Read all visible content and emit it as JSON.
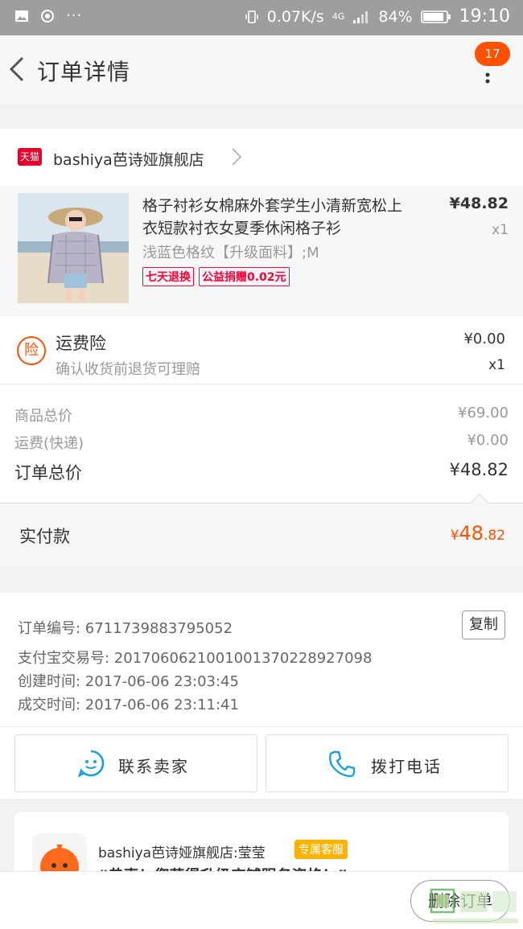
{
  "status_bar": {
    "network_speed": "0.07K/s",
    "network_type": "4G",
    "battery": "84%",
    "time": "19:10"
  },
  "nav": {
    "title": "订单详情",
    "badge_count": "17"
  },
  "shop": {
    "badge": "天猫",
    "name": "bashiya芭诗娅旗舰店"
  },
  "product": {
    "title": "格子衬衫女棉麻外套学生小清新宽松上衣短款衬衣女夏季休闲格子衫",
    "sku": "浅蓝色格纹【升级面料】;M",
    "price": "¥48.82",
    "quantity": "x1",
    "tags": [
      "七天退换",
      "公益捐赠0.02元"
    ]
  },
  "insurance": {
    "icon_char": "险",
    "title": "运费险",
    "desc": "确认收货前退货可理赔",
    "price": "¥0.00",
    "quantity": "x1"
  },
  "totals": {
    "goods_label": "商品总价",
    "goods_value": "¥69.00",
    "shipping_label": "运费(快递)",
    "shipping_value": "¥0.00",
    "order_label": "订单总价",
    "order_value": "¥48.82"
  },
  "paid": {
    "label": "实付款",
    "currency": "¥",
    "integer": "48",
    "cents": ".82"
  },
  "order_info": {
    "order_no": "订单编号: 6711739883795052",
    "alipay_no": "支付宝交易号: 2017060621001001370228927098",
    "created": "创建时间: 2017-06-06 23:03:45",
    "completed": "成交时间: 2017-06-06 23:11:41",
    "copy_label": "复制"
  },
  "actions": {
    "contact_seller": "联系卖家",
    "call": "拨打电话"
  },
  "chat_card": {
    "name": "bashiya芭诗娅旗舰店:莹莹",
    "badge": "专属客服",
    "message": "“恭喜！您获得升级店铺服务资格！”"
  },
  "bottom": {
    "delete_label": "删除订单"
  },
  "colors": {
    "accent": "#ff5000",
    "tmall_red": "#ff0036",
    "status_bar": "#9e9e9e",
    "vip_badge": "#ffb300"
  }
}
